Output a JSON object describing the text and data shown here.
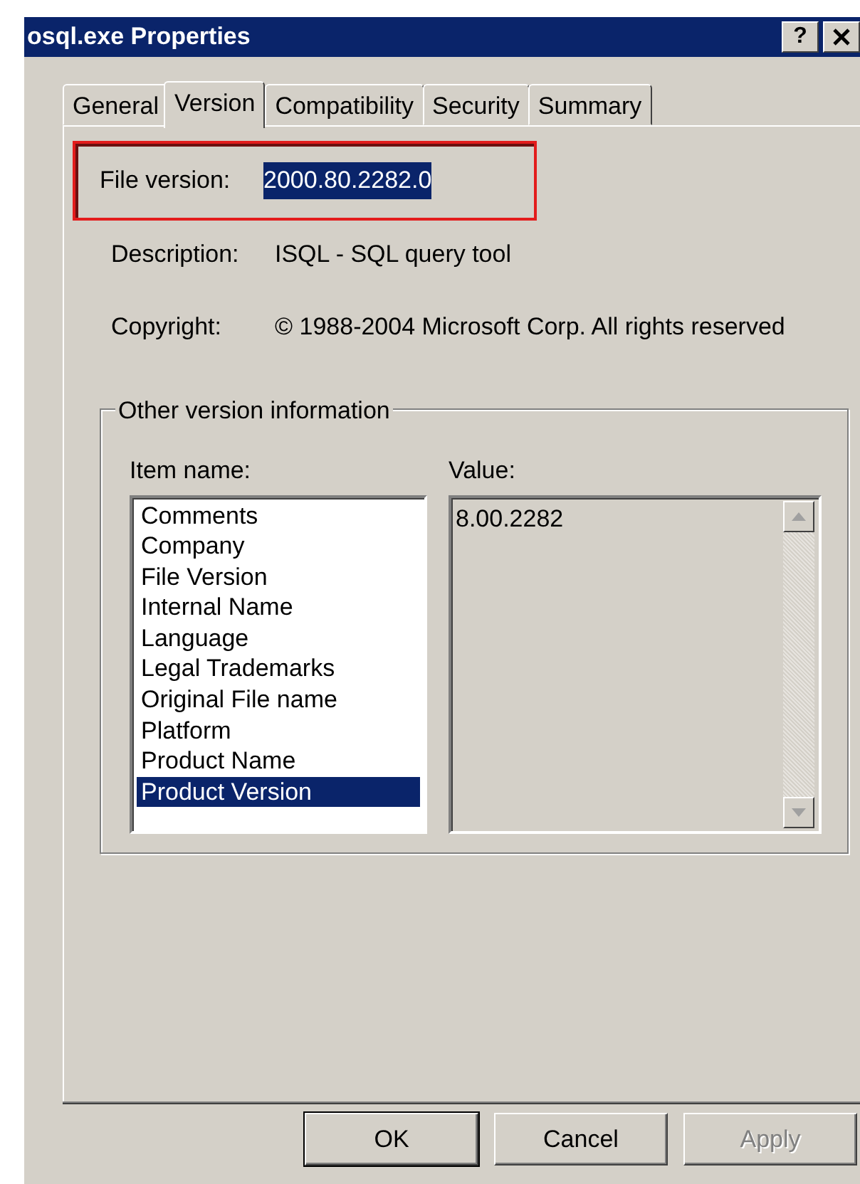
{
  "window": {
    "title": "osql.exe Properties",
    "help_button": "?"
  },
  "tabs": [
    {
      "label": "General",
      "selected": false
    },
    {
      "label": "Version",
      "selected": true
    },
    {
      "label": "Compatibility",
      "selected": false
    },
    {
      "label": "Security",
      "selected": false
    },
    {
      "label": "Summary",
      "selected": false
    }
  ],
  "fields": [
    {
      "label": "File version:",
      "value": "2000.80.2282.0",
      "selected": true,
      "highlighted": true
    },
    {
      "label": "Description:",
      "value": "ISQL - SQL query tool",
      "selected": false,
      "highlighted": false
    },
    {
      "label": "Copyright:",
      "value": "© 1988-2004 Microsoft Corp. All rights reserved",
      "selected": false,
      "highlighted": false
    }
  ],
  "other_version_info": {
    "title": "Other version information",
    "item_name_label": "Item name:",
    "value_label": "Value:",
    "items": [
      {
        "label": "Comments",
        "selected": false
      },
      {
        "label": "Company",
        "selected": false
      },
      {
        "label": "File Version",
        "selected": false
      },
      {
        "label": "Internal Name",
        "selected": false
      },
      {
        "label": "Language",
        "selected": false
      },
      {
        "label": "Legal Trademarks",
        "selected": false
      },
      {
        "label": "Original File name",
        "selected": false
      },
      {
        "label": "Platform",
        "selected": false
      },
      {
        "label": "Product Name",
        "selected": false
      },
      {
        "label": "Product Version",
        "selected": true
      }
    ],
    "value": "8.00.2282"
  },
  "buttons": [
    {
      "label": "OK",
      "disabled": false,
      "default": true
    },
    {
      "label": "Cancel",
      "disabled": false,
      "default": false
    },
    {
      "label": "Apply",
      "disabled": true,
      "default": false
    }
  ]
}
